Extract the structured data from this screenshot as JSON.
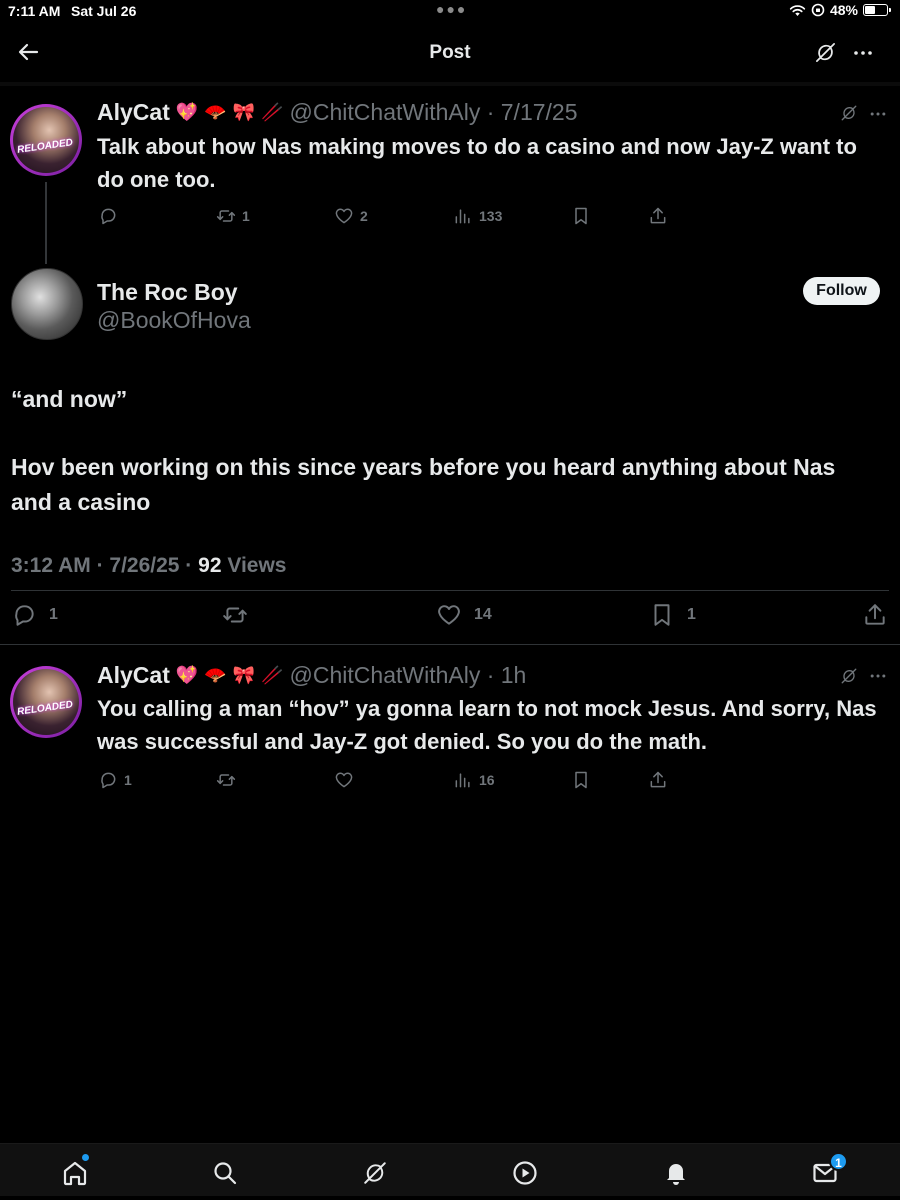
{
  "status_bar": {
    "time": "7:11 AM",
    "date": "Sat Jul 26",
    "battery": "48%",
    "battery_level": 0.48
  },
  "nav": {
    "title": "Post"
  },
  "parent_post": {
    "display_name": "AlyCat",
    "handle_line": "@ChitChatWithAly · 7/17/25",
    "avatar_text": "RELOADED",
    "text": "Talk about how Nas making moves to do a casino and now Jay-Z want to do one too.",
    "replies": "",
    "reposts": "1",
    "likes": "2",
    "views": "133"
  },
  "main_post": {
    "display_name": "The Roc Boy",
    "handle": "@BookOfHova",
    "follow_label": "Follow",
    "text_line1": "“and now”",
    "text_line2": "Hov been working on this since years before you heard anything about Nas and a casino",
    "meta_time": "3:12 AM · 7/26/25 · ",
    "views_count": "92",
    "views_label": " Views",
    "replies": "1",
    "reposts": "",
    "likes": "14",
    "bookmarks": "1"
  },
  "reply_post": {
    "display_name": "AlyCat",
    "handle_line": "@ChitChatWithAly · 1h",
    "avatar_text": "RELOADED",
    "text": "You calling a man “hov” ya gonna learn to not mock Jesus. And sorry, Nas was successful and Jay-Z got denied. So you do the math.",
    "replies": "1",
    "reposts": "",
    "likes": "",
    "views": "16"
  },
  "tab_bar": {
    "messages_badge": "1"
  },
  "colors": {
    "background": "#000000",
    "text": "#e7e9ea",
    "muted": "#71767b",
    "accent": "#1d9bf0",
    "divider": "#2f3336"
  }
}
